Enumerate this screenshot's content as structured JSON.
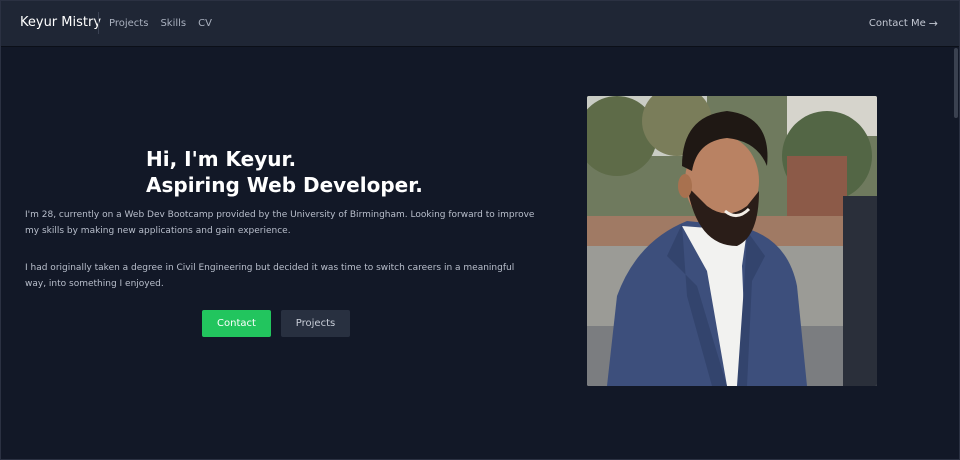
{
  "nav": {
    "brand": "Keyur Mistry",
    "links": [
      "Projects",
      "Skills",
      "CV"
    ],
    "contact": "Contact Me",
    "contact_icon": "arrow-right-icon"
  },
  "hero": {
    "heading_line1": "Hi, I'm Keyur.",
    "heading_line2": "Aspiring Web Developer.",
    "para1": "I'm 28, currently on a Web Dev Bootcamp provided by the University of Birmingham. Looking forward to improve my skills by making new applications and gain experience.",
    "para2": "I had originally taken a degree in Civil Engineering but decided it was time to switch careers in a meaningful way, into something I enjoyed.",
    "buttons": {
      "contact": "Contact",
      "projects": "Projects"
    }
  },
  "colors": {
    "background": "#121827",
    "nav": "#1f2635",
    "accent_green": "#22c55e",
    "secondary_button": "#283040"
  }
}
